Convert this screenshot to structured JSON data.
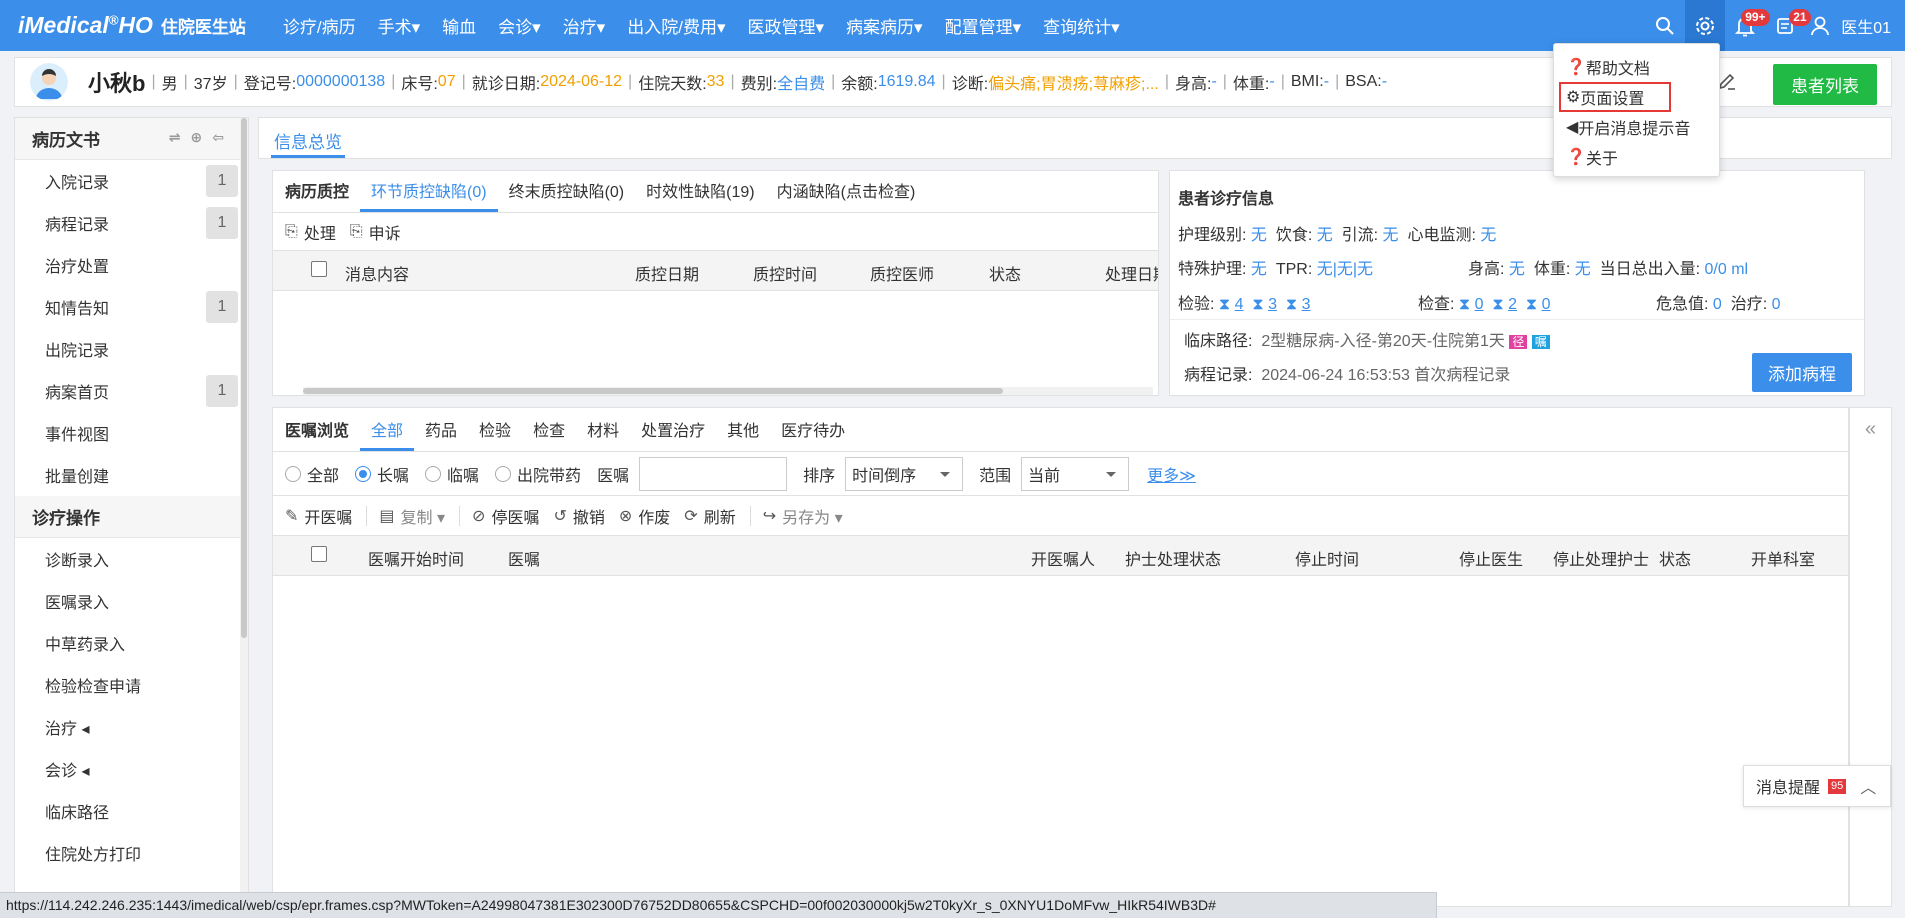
{
  "topbar": {
    "logo": "iMedical",
    "logo_suffix": "HO",
    "subtitle": "住院医生站",
    "menu": [
      "诊疗/病历",
      "手术▾",
      "输血",
      "会诊▾",
      "治疗▾",
      "出入院/费用▾",
      "医政管理▾",
      "病案病历▾",
      "配置管理▾",
      "查询统计▾"
    ],
    "bell_badge": "99+",
    "msg_badge": "21",
    "username": "医生01"
  },
  "patient": {
    "name": "小秋b",
    "gender": "男",
    "age": "37岁",
    "reg_label": "登记号:",
    "reg_no": "0000000138",
    "bed_label": "床号:",
    "bed": "07",
    "visit_label": "就诊日期:",
    "visit_date": "2024-06-12",
    "days_label": "住院天数:",
    "days": "33",
    "fee_label": "费别:",
    "fee": "全自费",
    "balance_label": "余额:",
    "balance": "1619.84",
    "diag_label": "诊断:",
    "diag": "偏头痛;胃溃疡;荨麻疹;...",
    "height_label": "身高:",
    "height": "-",
    "weight_label": "体重:",
    "weight": "-",
    "bmi_label": "BMI:",
    "bmi": "-",
    "bsa_label": "BSA:",
    "bsa": "-",
    "list_button": "患者列表"
  },
  "sidebar": {
    "section1": "病历文书",
    "docs": [
      {
        "label": "入院记录",
        "count": "1"
      },
      {
        "label": "病程记录",
        "count": "1"
      },
      {
        "label": "治疗处置",
        "count": ""
      },
      {
        "label": "知情告知",
        "count": "1"
      },
      {
        "label": "出院记录",
        "count": ""
      },
      {
        "label": "病案首页",
        "count": "1"
      },
      {
        "label": "事件视图",
        "count": ""
      },
      {
        "label": "批量创建",
        "count": ""
      }
    ],
    "section2": "诊疗操作",
    "ops": [
      "诊断录入",
      "医嘱录入",
      "中草药录入",
      "检验检查申请",
      "治疗 ◂",
      "会诊 ◂",
      "临床路径",
      "住院处方打印"
    ]
  },
  "main_tab": "信息总览",
  "qc": {
    "tabs": [
      "病历质控",
      "环节质控缺陷(0)",
      "终末质控缺陷(0)",
      "时效性缺陷(19)",
      "内涵缺陷(点击检查)"
    ],
    "tools": [
      "处理",
      "申诉"
    ],
    "columns": [
      "消息内容",
      "质控日期",
      "质控时间",
      "质控医师",
      "状态",
      "处理日期"
    ]
  },
  "info": {
    "title": "患者诊疗信息",
    "nurse_level_label": "护理级别:",
    "nurse_level": "无",
    "diet_label": "饮食:",
    "diet": "无",
    "drain_label": "引流:",
    "drain": "无",
    "ecg_label": "心电监测:",
    "ecg": "无",
    "special_label": "特殊护理:",
    "special": "无",
    "tpr_label": "TPR:",
    "tpr": "无|无|无",
    "height_label": "身高:",
    "height": "无",
    "weight_label": "体重:",
    "weight": "无",
    "io_label": "当日总出入量:",
    "io": "0/0 ml",
    "lab_label": "检验:",
    "lab1": "4",
    "lab2": "3",
    "lab3": "3",
    "exam_label": "检查:",
    "exam1": "0",
    "exam2": "2",
    "exam3": "0",
    "crit_label": "危急值:",
    "crit": "0",
    "treat_label": "治疗:",
    "treat": "0",
    "path_label": "临床路径:",
    "path": "2型糖尿病-入径-第20天-住院第1天",
    "path_tag1": "径",
    "path_tag2": "嘱",
    "record_label": "病程记录:",
    "record": "2024-06-24 16:53:53 首次病程记录",
    "add_button": "添加病程"
  },
  "orders": {
    "tabs": [
      "医嘱浏览",
      "全部",
      "药品",
      "检验",
      "检查",
      "材料",
      "处置治疗",
      "其他",
      "医疗待办"
    ],
    "radios": [
      "全部",
      "长嘱",
      "临嘱",
      "出院带药"
    ],
    "order_label": "医嘱",
    "sort_label": "排序",
    "sort_value": "时间倒序",
    "range_label": "范围",
    "range_value": "当前",
    "more": "更多≫",
    "tools": [
      "开医嘱",
      "复制 ▾",
      "停医嘱",
      "撤销",
      "作废",
      "刷新",
      "另存为 ▾"
    ],
    "columns": [
      "医嘱开始时间",
      "医嘱",
      "开医嘱人",
      "护士处理状态",
      "停止时间",
      "停止医生",
      "停止处理护士",
      "状态",
      "开单科室"
    ]
  },
  "dropdown": [
    "帮助文档",
    "页面设置",
    "开启消息提示音",
    "关于"
  ],
  "notify": {
    "label": "消息提醒",
    "count": "95"
  },
  "statusbar": "https://114.242.246.235:1443/imedical/web/csp/epr.frames.csp?MWToken=A24998047381E302300D76752DD80655&CSPCHD=00f002030000kj5w2T0kyXr_s_0XNYU1DoMFvw_HIkR54IWB3D#",
  "colors": {
    "primary": "#3b8ee9",
    "green": "#21ba45",
    "orange": "#f0a000",
    "red": "#e3393c"
  }
}
